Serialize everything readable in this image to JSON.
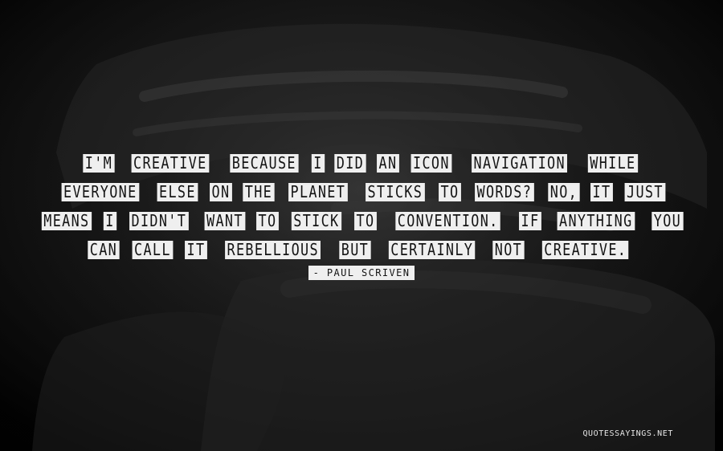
{
  "quote": {
    "lines": [
      [
        "I'M",
        "CREATIVE",
        "BECAUSE",
        "I",
        "DID",
        "AN",
        "ICON",
        "NAVIGATION",
        "WHILE"
      ],
      [
        "EVERYONE",
        "ELSE",
        "ON",
        "THE",
        "PLANET",
        "STICKS",
        "TO",
        "WORDS?",
        "NO,",
        "IT",
        "JUST"
      ],
      [
        "MEANS",
        "I",
        "DIDN'T",
        "WANT",
        "TO",
        "STICK",
        "TO",
        "CONVENTION.",
        "IF",
        "ANYTHING",
        "YOU"
      ],
      [
        "CAN",
        "CALL",
        "IT",
        "REBELLIOUS",
        "BUT",
        "CERTAINLY",
        "NOT",
        "CREATIVE."
      ]
    ]
  },
  "author": "- PAUL SCRIVEN",
  "site": "QUOTESSAYINGS.NET",
  "colors": {
    "background": "#111111",
    "label_background": "#efefef",
    "label_text": "#141414",
    "watermark_text": "#e6e6e6"
  }
}
